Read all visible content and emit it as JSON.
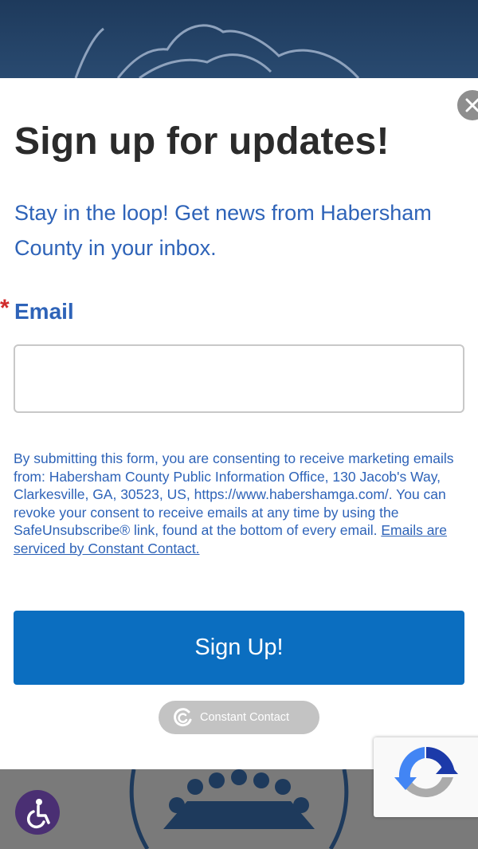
{
  "modal": {
    "title": "Sign up for updates!",
    "intro": "Stay in the loop! Get news from Habersham County in your inbox.",
    "required_marker": "*",
    "email_label": "Email",
    "email_value": "",
    "consent_text": "By submitting this form, you are consenting to receive marketing emails from: Habersham County Public Information Office, 130 Jacob's Way, Clarkesville, GA, 30523, US, https://www.habershamga.com/. You can revoke your consent to receive emails at any time by using the SafeUnsubscribe® link, found at the bottom of every email. ",
    "consent_link": "Emails are serviced by Constant Contact.",
    "submit_label": "Sign Up!",
    "badge_label": "Constant Contact"
  },
  "icons": {
    "close": "close-icon",
    "recaptcha": "recaptcha-icon",
    "accessibility": "accessibility-icon"
  },
  "colors": {
    "accent_blue": "#2e63b8",
    "button_blue": "#0b6ec0",
    "required_red": "#d12b2b",
    "header_navy": "#1e3a5c"
  }
}
